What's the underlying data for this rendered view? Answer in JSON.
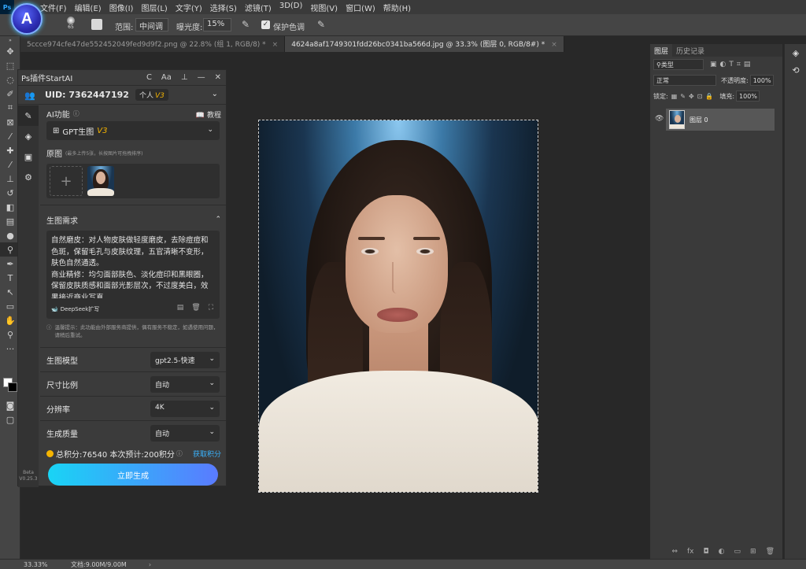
{
  "menubar": {
    "items": [
      "文件(F)",
      "编辑(E)",
      "图像(I)",
      "图层(L)",
      "文字(Y)",
      "选择(S)",
      "滤镜(T)",
      "3D(D)",
      "视图(V)",
      "窗口(W)",
      "帮助(H)"
    ],
    "ps_label": "Ps"
  },
  "options": {
    "brush_size": "65",
    "range_label": "范围:",
    "range_value": "中间调",
    "exposure_label": "曝光度:",
    "exposure_value": "15%",
    "protect_label": "保护色调"
  },
  "logo": {
    "letter": "A"
  },
  "tabs": [
    {
      "label": "5ccce974cfe47de552452049fed9d9f2.png @ 22.8% (组 1, RGB/8) *",
      "active": false
    },
    {
      "label": "4624a8af1749301fdd26bc0341ba566d.jpg @ 33.3% (图层 0, RGB/8#) *",
      "active": true
    }
  ],
  "plugin": {
    "title": "Ps插件StartAI",
    "title_ctrls": [
      "C",
      "Aa",
      "⊥",
      "—",
      "✕"
    ],
    "uid": "UID: 7362447192",
    "plan": "个人",
    "plan_version": "V3",
    "ai_function_label": "AI功能",
    "tutorial_label": "教程",
    "ai_function_value": "GPT生图",
    "ai_function_version": "V3",
    "source_label": "原图",
    "source_hint": "(最多上传5张，长按图片可拖拽排序)",
    "prompt_label": "生图需求",
    "prompt_text": "自然磨皮：对人物皮肤做轻度磨皮，去除痘痘和色斑，保留毛孔与皮肤纹理，五官清晰不变形，肤色自然通透。\n商业精修：均匀面部肤色、淡化痘印和黑眼圈，保留皮肤质感和面部光影层次，不过度美白，效果接近商业写真",
    "deepseek_label": "DeepSeek扩写",
    "notice": "温馨提示：此功能由外部服务商提供，偶有服务不稳定，如遇使用问题，请稍后重试。",
    "params": [
      {
        "label": "生图模型",
        "value": "gpt2.5-快速"
      },
      {
        "label": "尺寸比例",
        "value": "自动"
      },
      {
        "label": "分辨率",
        "value": "4K"
      },
      {
        "label": "生成质量",
        "value": "自动"
      }
    ],
    "points_text": "总积分:76540  本次预计:200积分",
    "get_points": "获取积分",
    "generate_btn": "立即生成",
    "beta": "Beta",
    "version": "V0.25.3"
  },
  "layers": {
    "tabs": [
      "图层",
      "历史记录"
    ],
    "filter_kind": "类型",
    "blend_mode": "正常",
    "opacity_label": "不透明度:",
    "opacity_value": "100%",
    "lock_label": "锁定:",
    "fill_label": "填充:",
    "fill_value": "100%",
    "layer_name": "图层 0",
    "footer_icons": [
      "⇔",
      "fx",
      "◘",
      "◐",
      "▭",
      "⊞",
      "🗑"
    ]
  },
  "status": {
    "zoom": "33.33%",
    "doc": "文档:9.00M/9.00M",
    "arrow": "›"
  }
}
